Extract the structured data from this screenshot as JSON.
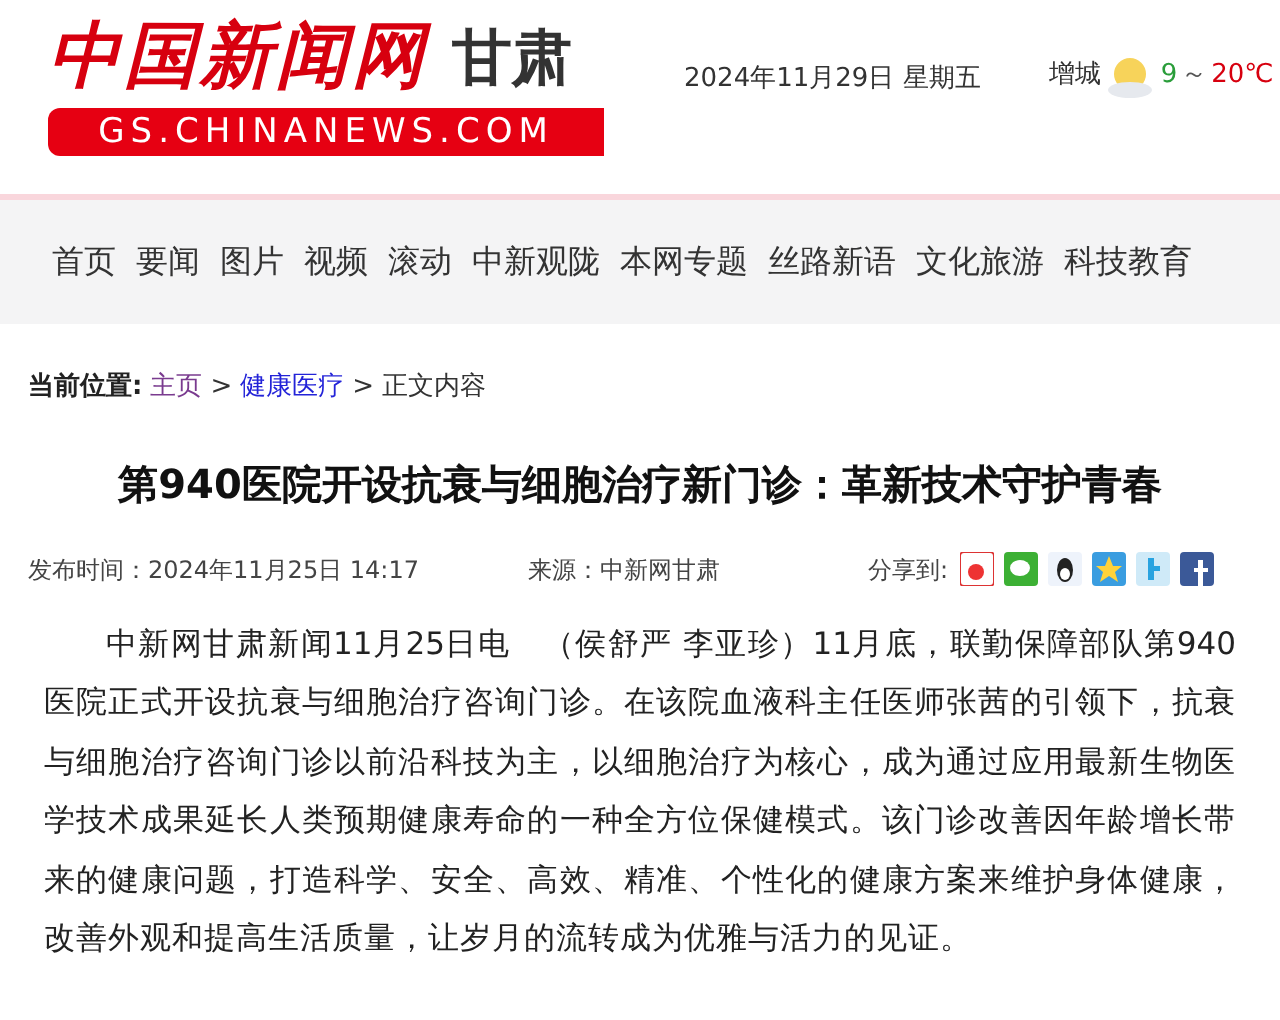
{
  "header": {
    "logo_text": "中国新闻网",
    "region": "甘肃",
    "domain": "GS.CHINANEWS.COM",
    "date": "2024年11月29日 星期五",
    "weather": {
      "city": "增城",
      "low": "9",
      "separator": "～",
      "high": "20℃"
    }
  },
  "nav": {
    "items": [
      {
        "label": "首页"
      },
      {
        "label": "要闻"
      },
      {
        "label": "图片"
      },
      {
        "label": "视频"
      },
      {
        "label": "滚动"
      },
      {
        "label": "中新观陇"
      },
      {
        "label": "本网专题"
      },
      {
        "label": "丝路新语"
      },
      {
        "label": "文化旅游"
      },
      {
        "label": "科技教育"
      }
    ]
  },
  "breadcrumb": {
    "label": "当前位置:",
    "items": [
      {
        "text": "主页",
        "kind": "link",
        "visited": true
      },
      {
        "text": "健康医疗",
        "kind": "link",
        "visited": false
      },
      {
        "text": "正文内容",
        "kind": "text"
      }
    ],
    "separator": ">"
  },
  "article": {
    "title": "第940医院开设抗衰与细胞治疗新门诊：革新技术守护青春",
    "published": "发布时间：2024年11月25日 14:17",
    "source": "来源：中新网甘肃",
    "share_label": "分享到:",
    "body": "中新网甘肃新闻11月25日电　（侯舒严 李亚珍）11月底，联勤保障部队第940医院正式开设抗衰与细胞治疗咨询门诊。在该院血液科主任医师张茜的引领下，抗衰与细胞治疗咨询门诊以前沿科技为主，以细胞治疗为核心，成为通过应用最新生物医学技术成果延长人类预期健康寿命的一种全方位保健模式。该门诊改善因年龄增长带来的健康问题，打造科学、安全、高效、精准、个性化的健康方案来维护身体健康，改善外观和提高生活质量，让岁月的流转成为优雅与活力的见证。"
  }
}
